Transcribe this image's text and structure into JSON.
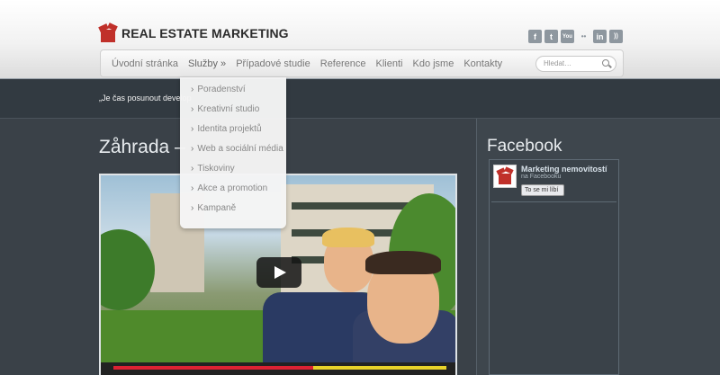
{
  "header": {
    "logo_text": "REAL ESTATE MARKETING",
    "social_icons": [
      "facebook-icon",
      "twitter-icon",
      "youtube-icon",
      "flickr-icon",
      "linkedin-icon",
      "rss-icon"
    ],
    "social_glyphs": [
      "f",
      "t",
      "You",
      "••",
      "in",
      "))"
    ]
  },
  "nav": {
    "items": [
      "Úvodní stránka",
      "Služby »",
      "Případové studie",
      "Reference",
      "Klienti",
      "Kdo jsme",
      "Kontakty"
    ],
    "search_placeholder": "Hledat…"
  },
  "dropdown": {
    "items": [
      "Poradenství",
      "Kreativní studio",
      "Identita projektů",
      "Web a sociální média",
      "Tiskoviny",
      "Akce a promotion",
      "Kampaně"
    ]
  },
  "tagline": "„Je čas posunout develop",
  "page_title": "Zåhrada –",
  "sidebar": {
    "title": "Facebook",
    "fb_name": "Marketing nemovitostí",
    "fb_sub": "na Facebooku",
    "fb_like": "To se mi líbí"
  },
  "colors": {
    "accent": "#c0302a",
    "background": "#3a4148",
    "header": "#f2f2f2"
  }
}
